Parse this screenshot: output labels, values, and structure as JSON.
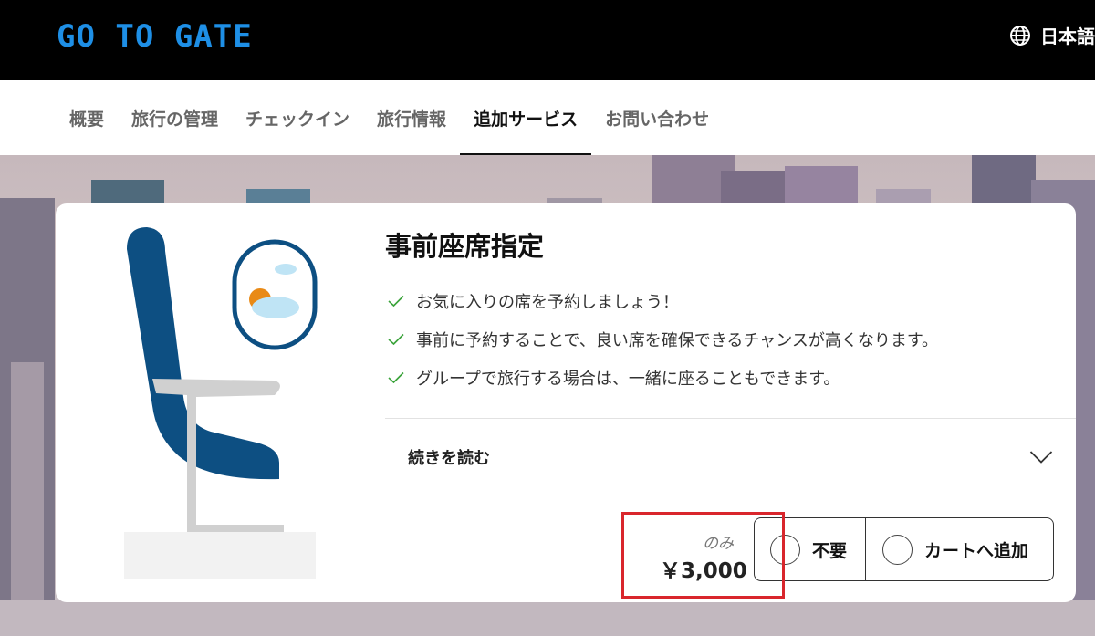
{
  "header": {
    "logo_text": "GO TO GATE",
    "language_label": "日本語"
  },
  "nav": {
    "items": [
      {
        "label": "概要"
      },
      {
        "label": "旅行の管理"
      },
      {
        "label": "チェックイン"
      },
      {
        "label": "旅行情報"
      },
      {
        "label": "追加サービス",
        "active": true
      },
      {
        "label": "お問い合わせ"
      }
    ]
  },
  "service": {
    "title": "事前座席指定",
    "features": [
      "お気に入りの席を予約しましょう！",
      "事前に予約することで、良い席を確保できるチャンスが高くなります。",
      "グループで旅行する場合は、一緒に座ることもできます。"
    ],
    "read_more_label": "続きを読む",
    "price_suffix": "のみ",
    "price": "￥3,000",
    "options": [
      {
        "label": "不要"
      },
      {
        "label": "カートへ追加"
      }
    ]
  },
  "colors": {
    "logo": "#1e8fe6",
    "highlight_box": "#d9262c",
    "check": "#3aa33a",
    "seat": "#0d4f82"
  },
  "icons": [
    "globe-icon",
    "check-icon",
    "chevron-down-icon",
    "seat-illustration",
    "window-illustration"
  ]
}
